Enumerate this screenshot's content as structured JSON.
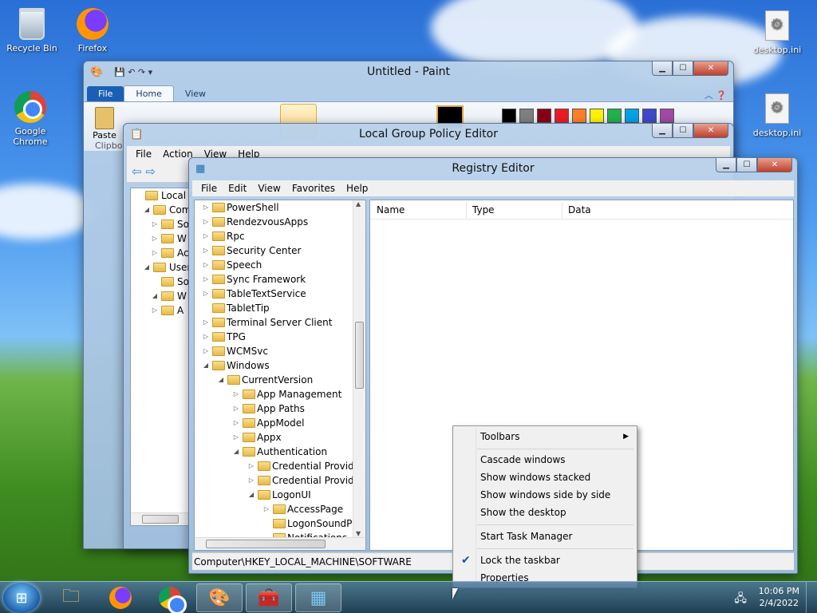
{
  "desktop": {
    "icons": [
      {
        "label": "Recycle Bin",
        "icon": "recycle-bin-icon"
      },
      {
        "label": "Firefox",
        "icon": "firefox-icon"
      },
      {
        "label": "Google Chrome",
        "icon": "chrome-icon"
      },
      {
        "label": "desktop.ini",
        "icon": "ini-file-icon"
      },
      {
        "label": "desktop.ini",
        "icon": "ini-file-icon"
      }
    ]
  },
  "paint": {
    "title": "Untitled - Paint",
    "tabs": [
      "File",
      "Home",
      "View"
    ],
    "paste_label": "Paste",
    "clipboard_label": "Clipbo",
    "palette": [
      "#000000",
      "#7f7f7f",
      "#880015",
      "#ed1c24",
      "#ff7f27",
      "#fff200",
      "#22b14c",
      "#00a2e8",
      "#3f48cc",
      "#a349a4"
    ]
  },
  "gpedit": {
    "title": "Local Group Policy Editor",
    "menu": [
      "File",
      "Action",
      "View",
      "Help"
    ],
    "tree": [
      {
        "label": "Local Co"
      },
      {
        "label": "Comp"
      },
      {
        "label": "So"
      },
      {
        "label": "W"
      },
      {
        "label": "Ac"
      },
      {
        "label": "User C"
      },
      {
        "label": "So"
      },
      {
        "label": "W"
      },
      {
        "label": "A"
      }
    ]
  },
  "regedit": {
    "title": "Registry Editor",
    "menu": [
      "File",
      "Edit",
      "View",
      "Favorites",
      "Help"
    ],
    "columns": [
      "Name",
      "Type",
      "Data"
    ],
    "tree": [
      {
        "label": "PowerShell",
        "depth": 0,
        "state": "collapsed"
      },
      {
        "label": "RendezvousApps",
        "depth": 0,
        "state": "collapsed"
      },
      {
        "label": "Rpc",
        "depth": 0,
        "state": "collapsed"
      },
      {
        "label": "Security Center",
        "depth": 0,
        "state": "collapsed"
      },
      {
        "label": "Speech",
        "depth": 0,
        "state": "collapsed"
      },
      {
        "label": "Sync Framework",
        "depth": 0,
        "state": "collapsed"
      },
      {
        "label": "TableTextService",
        "depth": 0,
        "state": "collapsed"
      },
      {
        "label": "TabletTip",
        "depth": 0,
        "state": "none"
      },
      {
        "label": "Terminal Server Client",
        "depth": 0,
        "state": "collapsed"
      },
      {
        "label": "TPG",
        "depth": 0,
        "state": "collapsed"
      },
      {
        "label": "WCMSvc",
        "depth": 0,
        "state": "collapsed"
      },
      {
        "label": "Windows",
        "depth": 0,
        "state": "expanded"
      },
      {
        "label": "CurrentVersion",
        "depth": 1,
        "state": "expanded"
      },
      {
        "label": "App Management",
        "depth": 2,
        "state": "collapsed"
      },
      {
        "label": "App Paths",
        "depth": 2,
        "state": "collapsed"
      },
      {
        "label": "AppModel",
        "depth": 2,
        "state": "collapsed"
      },
      {
        "label": "Appx",
        "depth": 2,
        "state": "collapsed"
      },
      {
        "label": "Authentication",
        "depth": 2,
        "state": "expanded"
      },
      {
        "label": "Credential Provide",
        "depth": 3,
        "state": "collapsed"
      },
      {
        "label": "Credential Provide",
        "depth": 3,
        "state": "collapsed"
      },
      {
        "label": "LogonUI",
        "depth": 3,
        "state": "expanded"
      },
      {
        "label": "AccessPage",
        "depth": 4,
        "state": "collapsed"
      },
      {
        "label": "LogonSoundPl",
        "depth": 4,
        "state": "none"
      },
      {
        "label": "Notifications",
        "depth": 4,
        "state": "none"
      }
    ],
    "status_path": "Computer\\HKEY_LOCAL_MACHINE\\SOFTWARE"
  },
  "context_menu": {
    "items": [
      {
        "label": "Toolbars",
        "submenu": true
      },
      {
        "label": "Cascade windows"
      },
      {
        "label": "Show windows stacked"
      },
      {
        "label": "Show windows side by side"
      },
      {
        "label": "Show the desktop"
      },
      {
        "label": "Start Task Manager"
      },
      {
        "label": "Lock the taskbar",
        "checked": true
      },
      {
        "label": "Properties"
      }
    ]
  },
  "taskbar": {
    "apps": [
      {
        "name": "explorer",
        "icon": "folder-icon"
      },
      {
        "name": "firefox",
        "icon": "firefox-icon"
      },
      {
        "name": "chrome",
        "icon": "chrome-icon"
      },
      {
        "name": "paint",
        "icon": "paint-icon",
        "open": true
      },
      {
        "name": "gpedit",
        "icon": "toolbox-icon",
        "open": true
      },
      {
        "name": "regedit",
        "icon": "registry-icon",
        "open": true
      }
    ],
    "time": "10:06 PM",
    "date": "2/4/2022"
  }
}
